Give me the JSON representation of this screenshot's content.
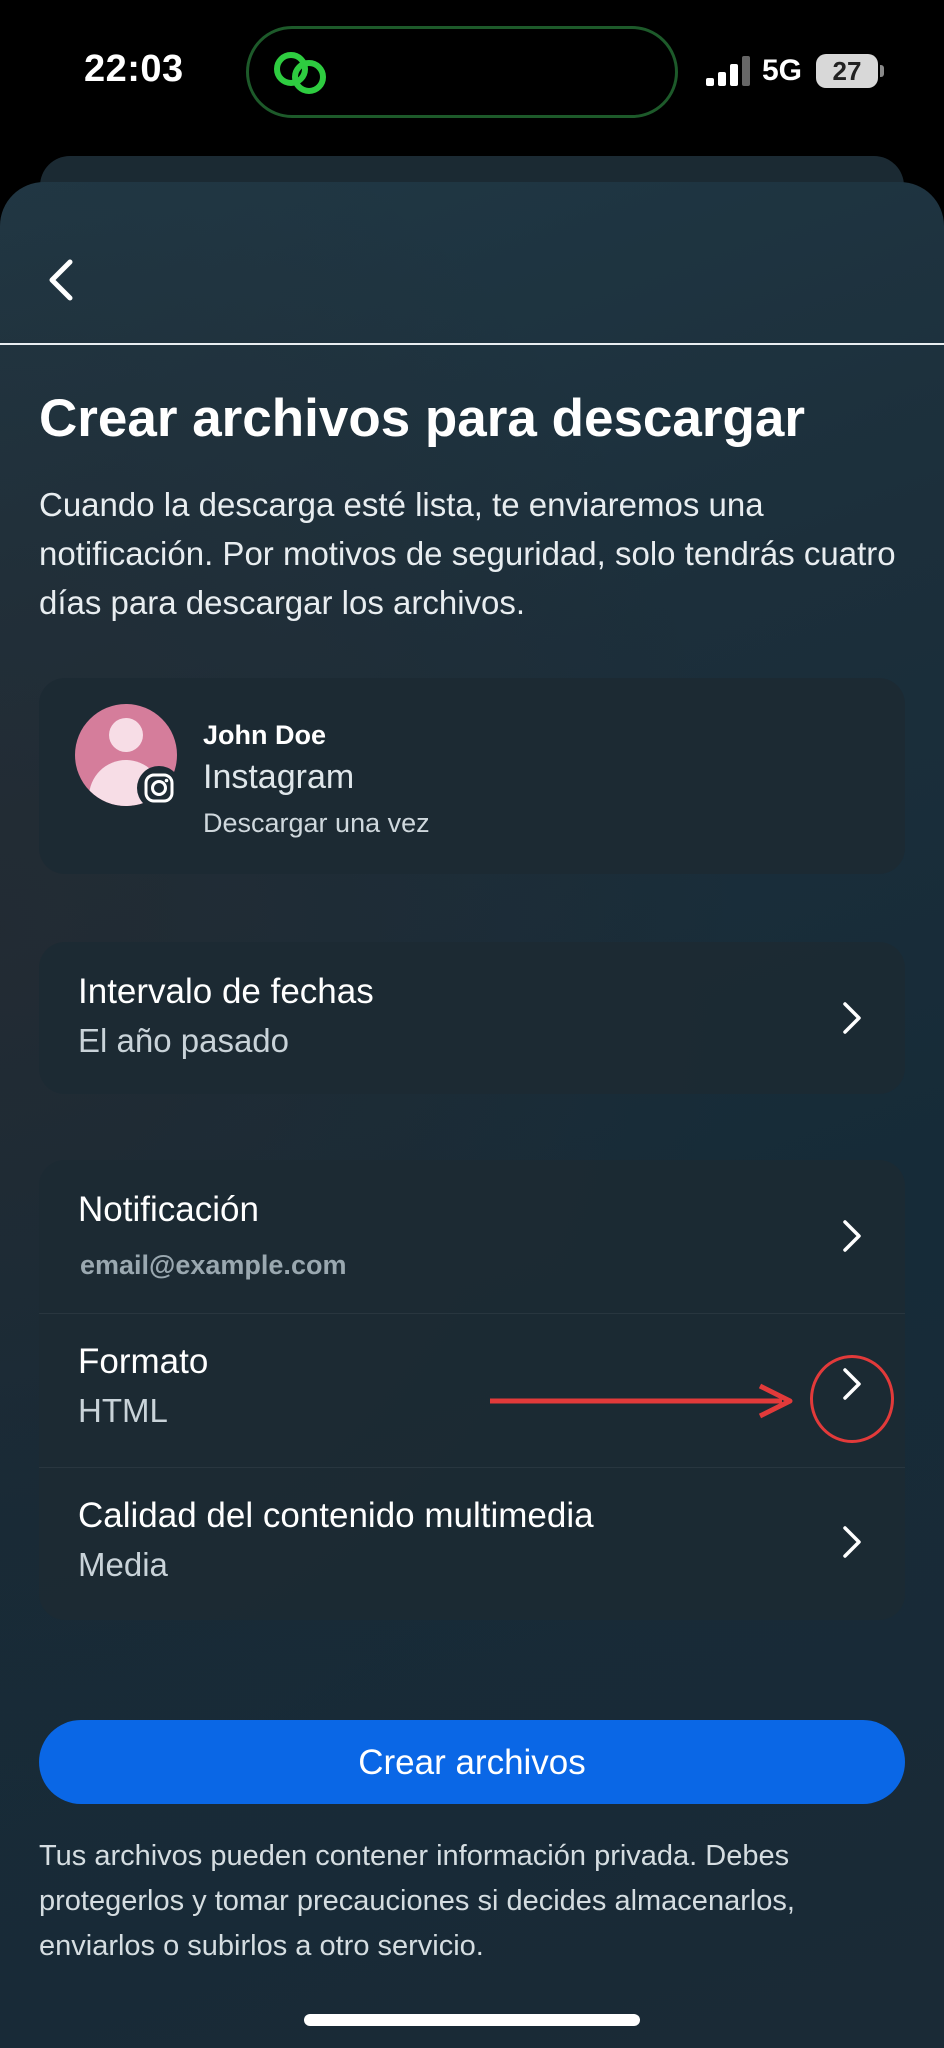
{
  "status_bar": {
    "time": "22:03",
    "network": "5G",
    "battery": "27"
  },
  "header": {
    "back_icon": "chevron-left-icon"
  },
  "page": {
    "title": "Crear archivos para descargar",
    "description": "Cuando la descarga esté lista, te enviaremos una notificación. Por motivos de seguridad, solo tendrás cuatro días para descargar los archivos."
  },
  "account": {
    "name": "John Doe",
    "app": "Instagram",
    "frequency": "Descargar una vez"
  },
  "date_range": {
    "label": "Intervalo de fechas",
    "value": "El año pasado"
  },
  "settings": {
    "notification": {
      "label": "Notificación",
      "value": "email@example.com"
    },
    "format": {
      "label": "Formato",
      "value": "HTML"
    },
    "media_quality": {
      "label": "Calidad del contenido multimedia",
      "value": "Media"
    }
  },
  "create_button": {
    "label": "Crear archivos"
  },
  "disclaimer": "Tus archivos pueden contener información privada. Debes protegerlos y tomar precauciones si decides almacenarlos, enviarlos o subirlos a otro servicio.",
  "colors": {
    "primary_button": "#0a67e6",
    "annotation": "#e23a3a",
    "status_icon_green": "#2ecc40"
  }
}
